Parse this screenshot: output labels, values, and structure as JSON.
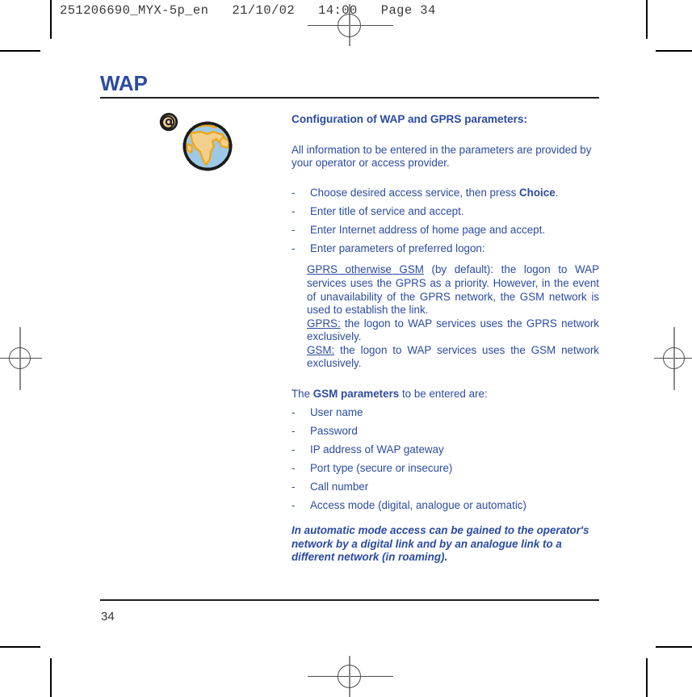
{
  "print_marks": {
    "registration_icon": "registration-target",
    "crop_icon": "crop-mark"
  },
  "imposition_header": {
    "text": "251206690_MYX-5p_en   21/10/02   14:00   Page 34"
  },
  "page": {
    "title": "WAP",
    "number": "34",
    "title_color": "#2b4ba3",
    "text_color": "#2b4ba3",
    "rule_color": "#231f20"
  },
  "illustration": {
    "globe_icon": "globe-icon",
    "at_icon": "at-sign-icon",
    "ocean_color": "#9dc9e8",
    "land_color": "#f2cf8c",
    "outline_color": "#f0a818"
  },
  "content": {
    "heading": "Configuration of WAP and GPRS parameters:",
    "intro": "All information to be entered in the parameters are provided by your operator or access provider.",
    "steps": [
      {
        "dash": "-",
        "pre": "Choose desired access service, then press ",
        "bold": "Choice",
        "post": "."
      },
      {
        "dash": "-",
        "pre": "Enter title of service and accept.",
        "bold": "",
        "post": ""
      },
      {
        "dash": "-",
        "pre": "Enter Internet address of home page and accept.",
        "bold": "",
        "post": ""
      },
      {
        "dash": "-",
        "pre": "Enter parameters of preferred logon:",
        "bold": "",
        "post": ""
      }
    ],
    "logon_options": [
      {
        "term": "GPRS otherwise GSM",
        "body": " (by default): the logon to WAP services uses the GPRS as a priority. However, in the event of unavailability of the GPRS network, the GSM network is used to establish the link."
      },
      {
        "term": "GPRS:",
        "body": " the logon to WAP services uses the GPRS network exclusively."
      },
      {
        "term": "GSM:",
        "body": " the logon to WAP services uses the GSM network exclusively."
      }
    ],
    "gsm_intro_pre": "The ",
    "gsm_intro_bold": "GSM parameters",
    "gsm_intro_post": " to be entered are:",
    "gsm_params": [
      {
        "dash": "-",
        "label": "User name"
      },
      {
        "dash": "-",
        "label": "Password"
      },
      {
        "dash": "-",
        "label": "IP address of WAP gateway"
      },
      {
        "dash": "-",
        "label": "Port type (secure or insecure)"
      },
      {
        "dash": "-",
        "label": "Call number"
      },
      {
        "dash": "-",
        "label": "Access mode (digital, analogue or automatic)"
      }
    ],
    "note": "In automatic mode access can be gained to the operator's network by a digital link and by an analogue link to a different network (in roaming)."
  }
}
